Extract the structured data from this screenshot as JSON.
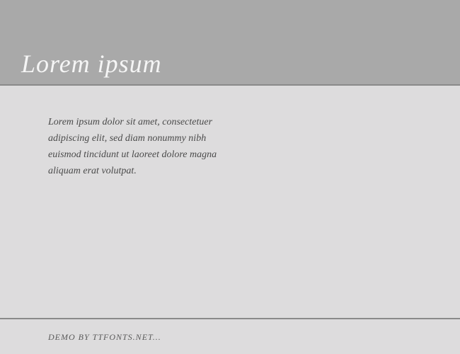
{
  "header": {
    "title": "Lorem ipsum"
  },
  "content": {
    "body": "Lorem ipsum dolor sit amet, consectetuer adipiscing elit, sed diam nonummy nibh euismod tincidunt ut laoreet dolore magna aliquam erat volutpat."
  },
  "footer": {
    "text": "DEMO BY TTFONTS.NET..."
  }
}
